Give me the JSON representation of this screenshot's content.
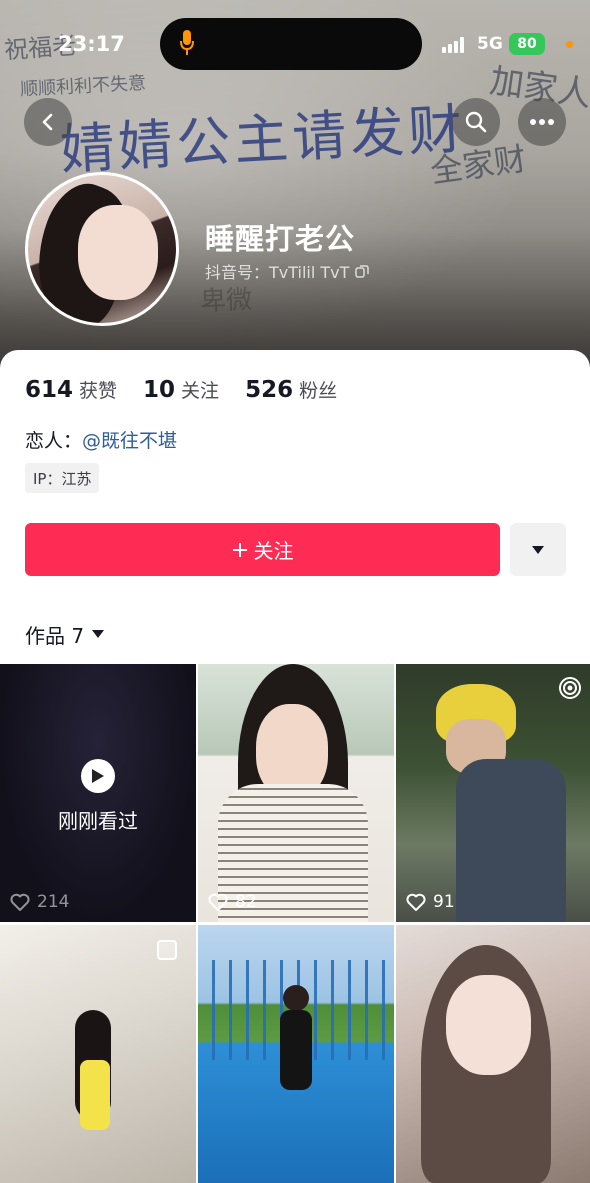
{
  "status_bar": {
    "time": "23:17",
    "network": "5G",
    "battery": "80"
  },
  "banner": {
    "graffiti_main": "婧婧公主请发财",
    "graffiti_1": "祝福老",
    "graffiti_2": "顺顺利利不失意",
    "graffiti_3": "全家财",
    "graffiti_4": "加家人",
    "graffiti_5": "卑微"
  },
  "profile": {
    "nickname": "睡醒打老公",
    "douyin_id": "抖音号：TvTilil TvT"
  },
  "stats": [
    {
      "value": "614",
      "label": "获赞"
    },
    {
      "value": "10",
      "label": "关注"
    },
    {
      "value": "526",
      "label": "粉丝"
    }
  ],
  "lover": {
    "label": "恋人：",
    "name": "@既往不堪"
  },
  "ip": "IP：江苏",
  "follow_button": {
    "label": "关注",
    "icon": "plus-icon"
  },
  "works": {
    "label": "作品 7"
  },
  "grid": [
    {
      "likes": "214",
      "overlay": "刚刚看过"
    },
    {
      "likes": "82"
    },
    {
      "likes": "91"
    },
    {
      "likes": ""
    },
    {
      "likes": ""
    },
    {
      "likes": ""
    }
  ],
  "colors": {
    "accent": "#fe2c55",
    "link": "#2f5d9a",
    "battery": "#34c759"
  }
}
